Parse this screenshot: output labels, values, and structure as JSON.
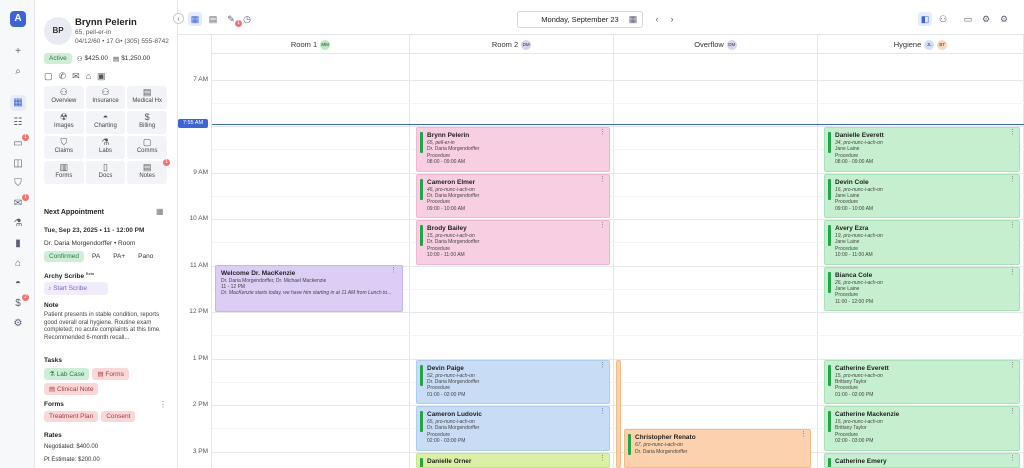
{
  "patient": {
    "initials": "BP",
    "name": "Brynn Pelerin",
    "detail": "65, pell-er-in",
    "contact": "04/12/60 • 17 G• (305) 555-8742",
    "status": "Active",
    "balance1": "$425.00",
    "balance2": "$1,250.00"
  },
  "grid": [
    {
      "label": "Overview",
      "icon": "person-icon"
    },
    {
      "label": "Insurance",
      "icon": "person-icon"
    },
    {
      "label": "Medical Hx",
      "icon": "clipboard-icon"
    },
    {
      "label": "Images",
      "icon": "radiation-icon"
    },
    {
      "label": "Charting",
      "icon": "tooth-icon"
    },
    {
      "label": "Billing",
      "icon": "dollar-icon"
    },
    {
      "label": "Claims",
      "icon": "shield-icon"
    },
    {
      "label": "Labs",
      "icon": "flask-icon"
    },
    {
      "label": "Comms",
      "icon": "chat-icon"
    },
    {
      "label": "Forms",
      "icon": "form-icon"
    },
    {
      "label": "Docs",
      "icon": "doc-icon"
    },
    {
      "label": "Notes",
      "icon": "note-icon",
      "badge": "1"
    }
  ],
  "next_appt": {
    "heading": "Next Appointment",
    "when": "Tue, Sep 23, 2025 • 11 - 12:00 PM",
    "who": "Dr. Daria Morgendorffer • Room",
    "status": "Confirmed",
    "chips": [
      "PA",
      "PA+",
      "Pano"
    ]
  },
  "scribe": {
    "heading": "Archy Scribe",
    "beta": "Beta",
    "button": "Start Scribe"
  },
  "note": {
    "heading": "Note",
    "text": "Patient presents in stable condition, reports good overall oral hygiene. Routine exam completed; no acute complaints at this time. Recommended 6-month recall..."
  },
  "tasks": {
    "heading": "Tasks",
    "items": [
      "Lab Case",
      "Forms",
      "Clinical Note"
    ]
  },
  "forms": {
    "heading": "Forms",
    "items": [
      "Treatment Plan",
      "Consent"
    ]
  },
  "rates": {
    "heading": "Rates",
    "negotiated": "Negotiated: $400.00",
    "estimate": "Pt Estimate: $200.00"
  },
  "topbar": {
    "date": "Monday, September 23",
    "badge": "1"
  },
  "columns": [
    {
      "name": "Room 1",
      "initials": [
        "MM"
      ],
      "colors": [
        "#b6ecc0"
      ]
    },
    {
      "name": "Room 2",
      "initials": [
        "DM"
      ],
      "colors": [
        "#d8d2f2"
      ]
    },
    {
      "name": "Overflow",
      "initials": [
        "DM"
      ],
      "colors": [
        "#d8d2f2"
      ]
    },
    {
      "name": "Hygiene",
      "initials": [
        "JL",
        "BT"
      ],
      "colors": [
        "#cfe0f8",
        "#fbd6b6"
      ]
    }
  ],
  "times": [
    "7 AM",
    "8 AM",
    "9 AM",
    "10 AM",
    "11 AM",
    "12 PM",
    "1 PM",
    "2 PM",
    "3 PM"
  ],
  "now": "7:55 AM",
  "rail_badges": [
    "1",
    "1",
    "2"
  ],
  "welcome": {
    "title": "Welcome Dr. MacKenzie",
    "l1": "Dr. Daria Morgendorffer, Dr. Michael Mackenzie",
    "l2": "11 - 12 PM",
    "l3": "Dr. MacKenzie starts today, we have him starting in at 11 AM from Lunch to..."
  },
  "appointments": [
    {
      "col": 1,
      "start": 8,
      "end": 9,
      "color": "pink",
      "name": "Brynn Pelerin",
      "sub": "65, pell-er-in",
      "doc": "Dr. Daria Morgendorffer",
      "proc": "Procedure",
      "time": "08:00 - 09:00 AM"
    },
    {
      "col": 1,
      "start": 9,
      "end": 10,
      "color": "pink",
      "name": "Cameron Elmer",
      "sub": "46, pro-nunc-i-ach-on",
      "doc": "Dr. Daria Morgendorffer",
      "proc": "Procedure",
      "time": "09:00 - 10:00 AM"
    },
    {
      "col": 1,
      "start": 10,
      "end": 11,
      "color": "pink",
      "name": "Brody Bailey",
      "sub": "15, pro-nunc-i-ach-on",
      "doc": "Dr. Daria Morgendorffer",
      "proc": "Procedure",
      "time": "10:00 - 11:00 AM"
    },
    {
      "col": 1,
      "start": 13,
      "end": 14,
      "color": "blue",
      "name": "Devin Paige",
      "sub": "52, pro-nunc-i-ach-on",
      "doc": "Dr. Daria Morgendorffer",
      "proc": "Procedure",
      "time": "01:00 - 02:00 PM"
    },
    {
      "col": 1,
      "start": 14,
      "end": 15,
      "color": "blue",
      "name": "Cameron Ludovic",
      "sub": "65, pro-nunc-i-ach-on",
      "doc": "Dr. Daria Morgendorffer",
      "proc": "Procedure",
      "time": "02:00 - 03:00 PM"
    },
    {
      "col": 1,
      "start": 15,
      "end": 16,
      "color": "lime",
      "name": "Danielle Orner",
      "sub": "",
      "doc": "",
      "proc": "",
      "time": ""
    },
    {
      "col": 3,
      "start": 8,
      "end": 9,
      "color": "green",
      "name": "Danielle Everett",
      "sub": "34, pro-nunc-i-ach-on",
      "doc": "Jane Laine",
      "proc": "Procedure",
      "time": "08:00 - 09:00 AM"
    },
    {
      "col": 3,
      "start": 9,
      "end": 10,
      "color": "green",
      "name": "Devin Cole",
      "sub": "16, pro-nunc-i-ach-on",
      "doc": "Jane Laine",
      "proc": "Procedure",
      "time": "09:00 - 10:00 AM"
    },
    {
      "col": 3,
      "start": 10,
      "end": 11,
      "color": "green",
      "name": "Avery Ezra",
      "sub": "19, pro-nunc-i-ach-on",
      "doc": "Jane Laine",
      "proc": "Procedure",
      "time": "10:00 - 11:00 AM"
    },
    {
      "col": 3,
      "start": 11,
      "end": 12,
      "color": "green",
      "name": "Bianca Cole",
      "sub": "26, pro-nunc-i-ach-on",
      "doc": "Jane Laine",
      "proc": "Procedure",
      "time": "11:00 - 12:00 PM"
    },
    {
      "col": 3,
      "start": 13,
      "end": 14,
      "color": "green",
      "name": "Catherine Everett",
      "sub": "15, pro-nunc-i-ach-on",
      "doc": "Brittany Taylor",
      "proc": "Procedure",
      "time": "01:00 - 02:00 PM"
    },
    {
      "col": 3,
      "start": 14,
      "end": 15,
      "color": "green",
      "name": "Catherine Mackenzie",
      "sub": "15, pro-nunc-i-ach-on",
      "doc": "Brittany Taylor",
      "proc": "Procedure",
      "time": "02:00 - 03:00 PM"
    },
    {
      "col": 3,
      "start": 15,
      "end": 16,
      "color": "green",
      "name": "Catherine Emery",
      "sub": "",
      "doc": "",
      "proc": "",
      "time": ""
    },
    {
      "col": 2,
      "start": 14.5,
      "end": 16,
      "color": "orange",
      "name": "Christopher Renato",
      "sub": "67, pro-nunc-i-ach-on",
      "doc": "Dr. Daria Morgendorffer",
      "proc": "",
      "time": ""
    }
  ]
}
